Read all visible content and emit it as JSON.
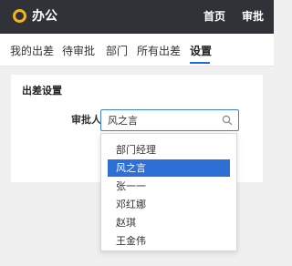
{
  "header": {
    "app_title": "办公",
    "nav": [
      {
        "label": "首页"
      },
      {
        "label": "审批"
      }
    ]
  },
  "tabs": [
    {
      "label": "我的出差"
    },
    {
      "label": "待审批"
    },
    {
      "label": "部门"
    },
    {
      "label": "所有出差"
    },
    {
      "label": "设置",
      "active": true
    }
  ],
  "settings": {
    "section_title": "出差设置",
    "approver_label": "审批人",
    "approver_value": "风之言",
    "options": [
      {
        "label": "部门经理"
      },
      {
        "label": "风之言",
        "selected": true
      },
      {
        "label": "张一一"
      },
      {
        "label": "邓红娜"
      },
      {
        "label": "赵琪"
      },
      {
        "label": "王金伟"
      }
    ]
  },
  "colors": {
    "header_bg": "#2f3237",
    "logo_ring": "#f2b324",
    "accent": "#2e6fd6"
  },
  "icons": {
    "logo": "ring-logo-icon",
    "select": "search-icon"
  }
}
